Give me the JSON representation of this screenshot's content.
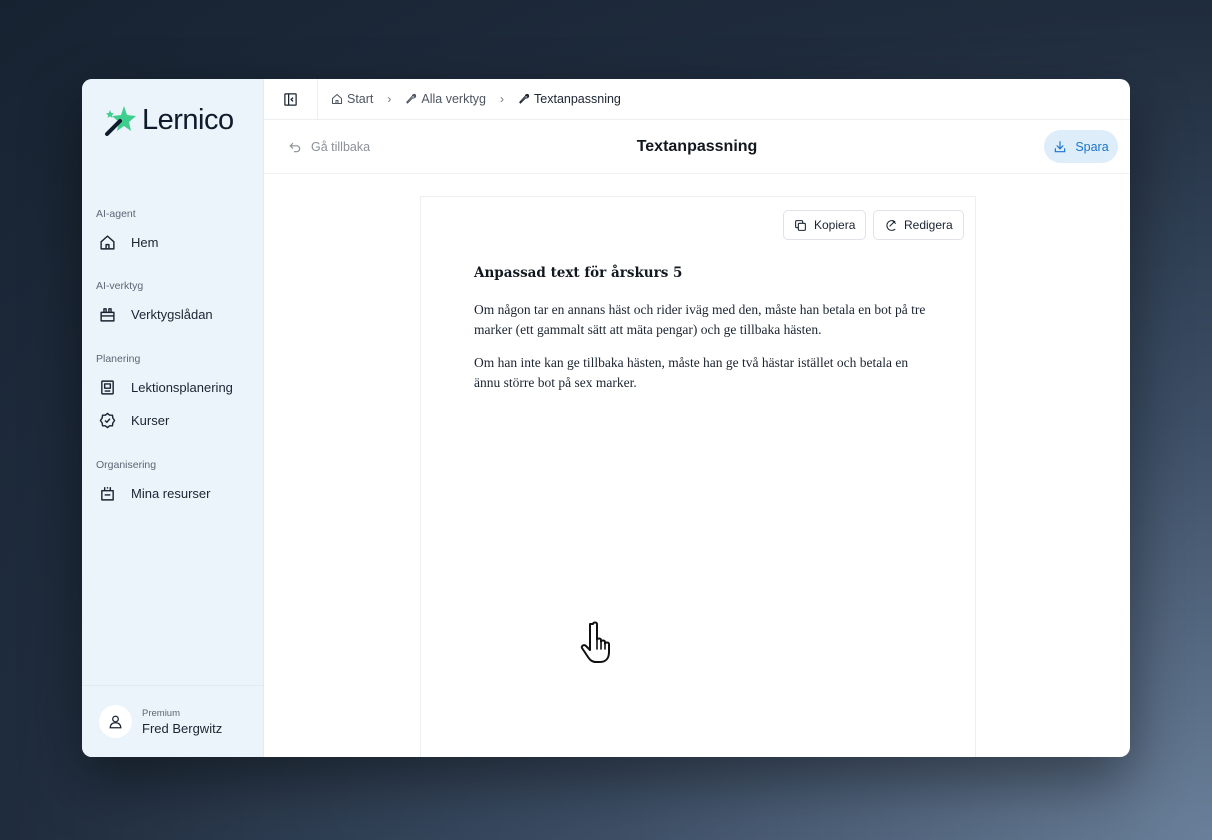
{
  "app": {
    "logo_text": "Lernico",
    "brand_color": "#3ecf8e"
  },
  "sidebar": {
    "sections": [
      {
        "heading": "AI-agent",
        "items": [
          {
            "label": "Hem",
            "icon": "home-icon"
          }
        ]
      },
      {
        "heading": "AI-verktyg",
        "items": [
          {
            "label": "Verktygslådan",
            "icon": "toolbox-icon"
          }
        ]
      },
      {
        "heading": "Planering",
        "items": [
          {
            "label": "Lektionsplanering",
            "icon": "lesson-plan-icon"
          },
          {
            "label": "Kurser",
            "icon": "course-badge-icon"
          }
        ]
      },
      {
        "heading": "Organisering",
        "items": [
          {
            "label": "Mina resurser",
            "icon": "resources-icon"
          }
        ]
      }
    ],
    "user": {
      "plan": "Premium",
      "name": "Fred Bergwitz",
      "icon": "user-icon"
    }
  },
  "topbar": {
    "breadcrumbs": [
      {
        "label": "Start",
        "icon": "home-icon"
      },
      {
        "label": "Alla verktyg",
        "icon": "wrench-icon"
      },
      {
        "label": "Textanpassning",
        "icon": "wrench-icon"
      }
    ]
  },
  "header": {
    "back_label": "Gå tillbaka",
    "title": "Textanpassning",
    "save_label": "Spara"
  },
  "document": {
    "copy_label": "Kopiera",
    "edit_label": "Redigera",
    "heading": "Anpassad text för årskurs 5",
    "paragraphs": [
      "Om någon tar en annans häst och rider iväg med den, måste han betala en bot på tre marker (ett gammalt sätt att mäta pengar) och ge tillbaka hästen.",
      "Om han inte kan ge tillbaka hästen, måste han ge två hästar istället och betala en ännu större bot på sex marker."
    ]
  }
}
